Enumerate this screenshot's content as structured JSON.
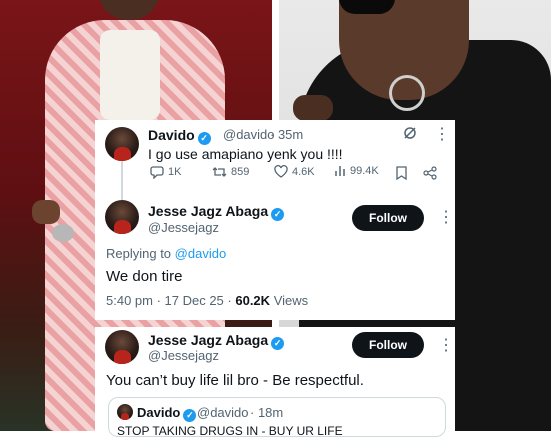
{
  "tweet1": {
    "name": "Davido",
    "handle": "@davido",
    "time": "· 35m",
    "text": "I go use amapiano yenk you !!!!",
    "stats": {
      "replies": "1K",
      "retweets": "859",
      "likes": "4.6K",
      "views": "99.4K"
    }
  },
  "reply": {
    "name": "Jesse Jagz Abaga",
    "handle": "@Jessejagz",
    "follow_label": "Follow",
    "replying_prefix": "Replying to",
    "replying_to": "@davido",
    "text": "We don tire",
    "meta": "5:40 pm · 17 Dec 25 ·",
    "views_count": "60.2K",
    "views_label": "Views"
  },
  "tweet2": {
    "name": "Jesse Jagz Abaga",
    "handle": "@Jessejagz",
    "follow_label": "Follow",
    "text": "You can’t buy life lil bro - Be respectful.",
    "quoted": {
      "name": "Davido",
      "handle": "@davido",
      "time": "· 18m",
      "text": "STOP TAKING DRUGS IN - BUY UR LIFE"
    }
  },
  "colors": {
    "accent": "#1d9bf0",
    "text": "#0f1419",
    "muted": "#536471",
    "follow_bg": "#0f1419"
  }
}
